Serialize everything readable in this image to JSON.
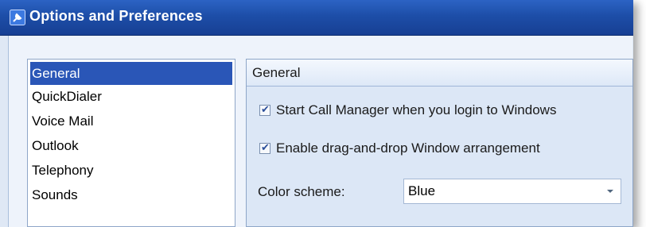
{
  "window": {
    "title": "Options and Preferences"
  },
  "categories": [
    {
      "label": "General",
      "selected": true
    },
    {
      "label": "QuickDialer",
      "selected": false
    },
    {
      "label": "Voice Mail",
      "selected": false
    },
    {
      "label": "Outlook",
      "selected": false
    },
    {
      "label": "Telephony",
      "selected": false
    },
    {
      "label": "Sounds",
      "selected": false
    }
  ],
  "panel": {
    "header": "General",
    "options": [
      {
        "label": "Start Call Manager when you login to Windows",
        "checked": true
      },
      {
        "label": "Enable drag-and-drop Window arrangement",
        "checked": true
      }
    ],
    "color_scheme": {
      "label": "Color scheme:",
      "value": "Blue"
    }
  },
  "colors": {
    "titlebar": "#1d4ea8",
    "selection": "#2a56b7",
    "panel_bg": "#dce7f6"
  },
  "icons": {
    "title": "options-icon",
    "dropdown": "chevron-down-icon",
    "check": "checkmark-icon"
  }
}
